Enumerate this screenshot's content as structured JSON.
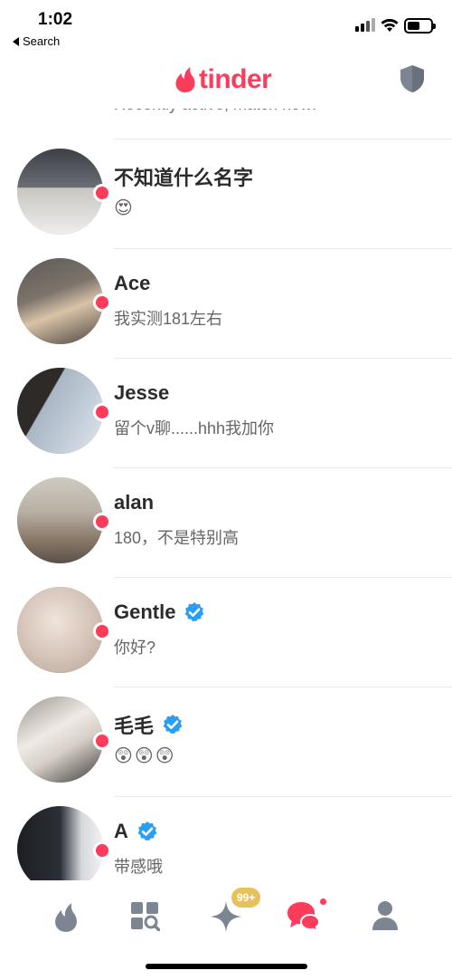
{
  "status_bar": {
    "time": "1:02",
    "back_label": "Search"
  },
  "header": {
    "logo_text": "tinder"
  },
  "partial_row": {
    "message": "Recently active, match now!"
  },
  "matches": [
    {
      "name": "不知道什么名字",
      "message": "😍",
      "verified": false
    },
    {
      "name": "Ace",
      "message": "我实测181左右",
      "verified": false
    },
    {
      "name": "Jesse",
      "message": "留个v聊......hhh我加你",
      "verified": false
    },
    {
      "name": "alan",
      "message": "180，不是特别高",
      "verified": false
    },
    {
      "name": "Gentle",
      "message": "你好?",
      "verified": true
    },
    {
      "name": "毛毛",
      "message": "😲😲😲",
      "verified": true
    },
    {
      "name": "A",
      "message": "带感哦",
      "verified": true
    }
  ],
  "tabbar": {
    "badge": "99+"
  },
  "colors": {
    "brand": "#fd3b5a",
    "verified": "#2a9df4",
    "badge": "#e7c15a",
    "icon_gray": "#7c8591"
  },
  "icons": [
    "flame-icon",
    "explore-grid-icon",
    "sparkle-icon",
    "chat-bubbles-icon",
    "profile-icon",
    "shield-icon"
  ]
}
